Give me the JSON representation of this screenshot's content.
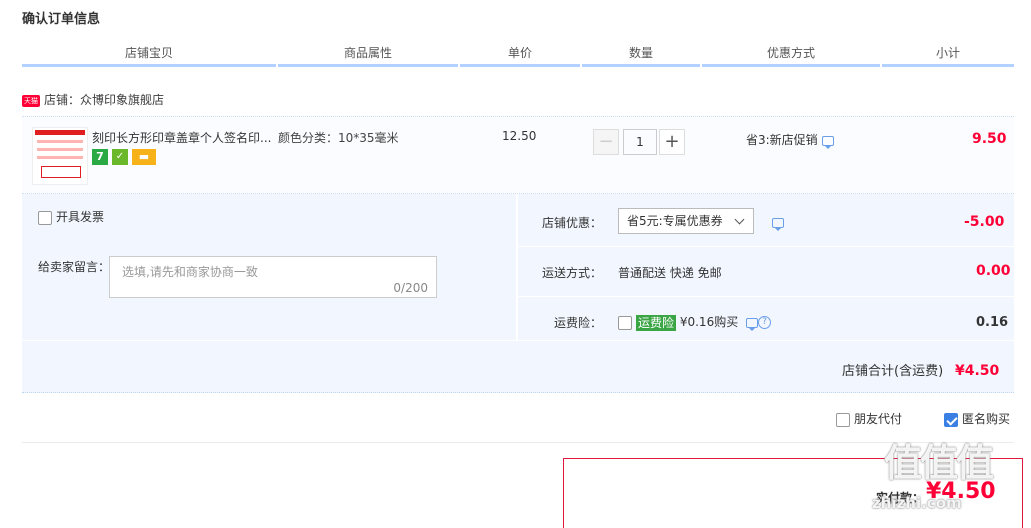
{
  "page": {
    "title": "确认订单信息"
  },
  "columns": [
    "店铺宝贝",
    "商品属性",
    "单价",
    "数量",
    "优惠方式",
    "小计"
  ],
  "shop": {
    "badge": "天猫",
    "label": "店铺：",
    "name": "众博印象旗舰店"
  },
  "item": {
    "name": "刻印长方形印章盖章个人签名印...",
    "attribute": "颜色分类：10*35毫米",
    "unit_price": "12.50",
    "quantity": "1",
    "minus": "−",
    "plus": "+",
    "promo": "省3:新店促销",
    "subtotal": "9.50",
    "badges": [
      "7"
    ]
  },
  "invoice": {
    "label": "开具发票"
  },
  "message": {
    "label": "给卖家留言：",
    "placeholder": "选填,请先和商家协商一致",
    "counter": "0/200"
  },
  "shop_discount": {
    "label": "店铺优惠：",
    "selected": "省5元:专属优惠券",
    "amount": "-5.00"
  },
  "shipping": {
    "label": "运送方式：",
    "value": "普通配送 快递 免邮",
    "amount": "0.00"
  },
  "insurance": {
    "label": "运费险：",
    "tag": "运费险",
    "price": "¥0.16购买",
    "help": "?",
    "amount": "0.16"
  },
  "shop_total": {
    "label": "店铺合计(含运费)",
    "value": "¥4.50"
  },
  "options": {
    "friend_pay": "朋友代付",
    "anonymous": "匿名购买"
  },
  "pay": {
    "label": "实付款：",
    "value": "¥4.50"
  },
  "watermark": {
    "brand": "值值值",
    "site": "zhizhi.com"
  },
  "colors": {
    "accent": "#ff0036",
    "header_line": "#b2d1ff",
    "panel": "#f2f7ff",
    "insurance": "#3aa545"
  }
}
